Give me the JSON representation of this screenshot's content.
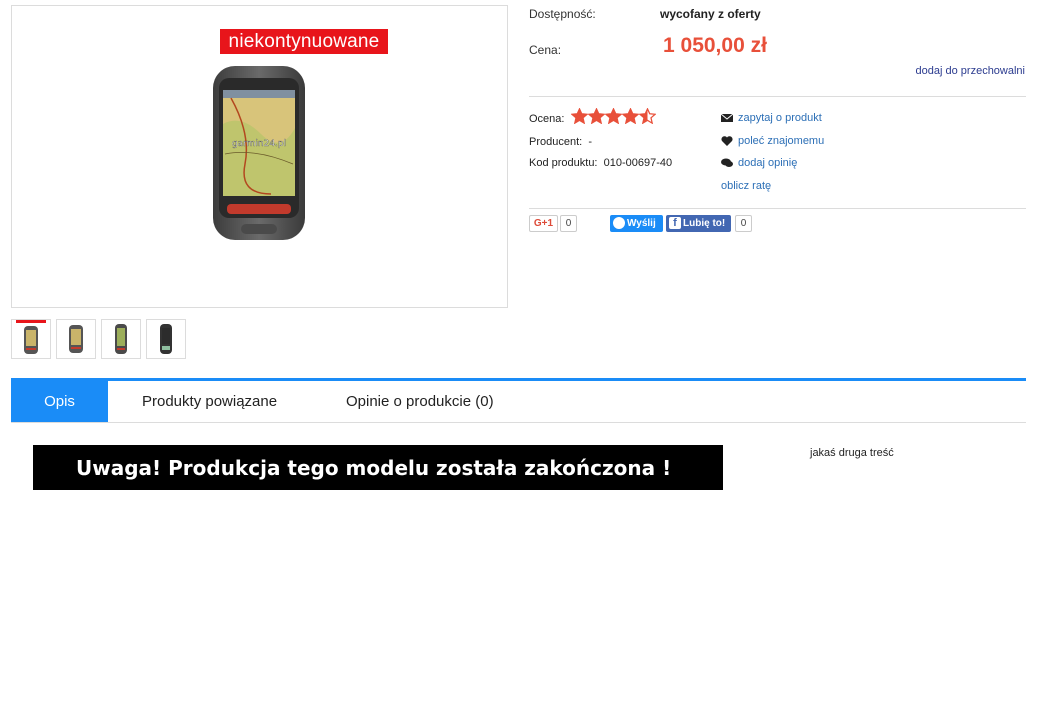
{
  "product": {
    "badge": "niekontynuowane",
    "map_watermark": "garmin24.pl"
  },
  "thumbnails": [
    "thumb-1",
    "thumb-2",
    "thumb-3",
    "thumb-4"
  ],
  "info": {
    "availability_label": "Dostępność:",
    "availability_value": "wycofany z oferty",
    "price_label": "Cena:",
    "price_value": "1 050,00 zł",
    "store_link": "dodaj do przechowalni",
    "rating_label": "Ocena:",
    "rating_value": 4.5,
    "rating_max": 5,
    "producer_label": "Producent:",
    "producer_value": "-",
    "code_label": "Kod produktu:",
    "code_value": "010-00697-40"
  },
  "actions": {
    "ask": "zapytaj o produkt",
    "recommend": "poleć znajomemu",
    "add_review": "dodaj opinię",
    "installment": "oblicz ratę"
  },
  "social": {
    "gplus_label": "G+1",
    "gplus_count": "0",
    "messenger_label": "Wyślij",
    "fb_label": "Lubię to!",
    "fb_count": "0"
  },
  "tabs": [
    {
      "label": "Opis"
    },
    {
      "label": "Produkty powiązane"
    },
    {
      "label": "Opinie o produkcie (0)"
    }
  ],
  "content": {
    "banner_line1": "Uwaga! Produkcja tego modelu została zakończona !",
    "side_note": "jakaś druga treść"
  },
  "colors": {
    "accent": "#1a8cf7",
    "price": "#e8503a",
    "badge": "#e8151b",
    "star": "#e8503a",
    "link": "#2c6fb6"
  }
}
